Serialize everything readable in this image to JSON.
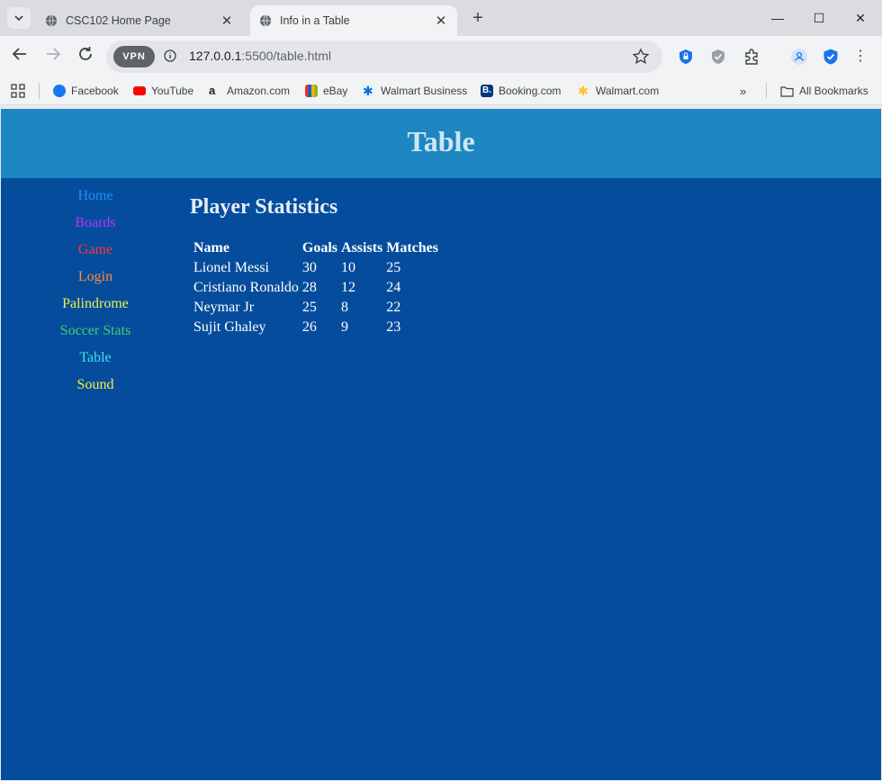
{
  "browser": {
    "tabs": [
      {
        "title": "CSC102 Home Page",
        "active": false
      },
      {
        "title": "Info in a Table",
        "active": true
      }
    ],
    "url_host": "127.0.0.1",
    "url_rest": ":5500/table.html",
    "vpn_label": "VPN",
    "bookmarks": [
      {
        "label": "Facebook",
        "icon": "facebook-icon",
        "color": "#1877f2"
      },
      {
        "label": "YouTube",
        "icon": "youtube-icon",
        "color": "#ff0000"
      },
      {
        "label": "Amazon.com",
        "icon": "amazon-icon",
        "color": "#222222"
      },
      {
        "label": "eBay",
        "icon": "ebay-icon",
        "color": "#e53238"
      },
      {
        "label": "Walmart Business",
        "icon": "walmart-business-icon",
        "color": "#0071dc"
      },
      {
        "label": "Booking.com",
        "icon": "booking-icon",
        "color": "#003580"
      },
      {
        "label": "Walmart.com",
        "icon": "walmart-icon",
        "color": "#ffc220"
      }
    ],
    "all_bookmarks": "All Bookmarks"
  },
  "page": {
    "title": "Table",
    "nav": [
      {
        "label": "Home",
        "color": "#1e90ff"
      },
      {
        "label": "Boards",
        "color": "#b533ff"
      },
      {
        "label": "Game",
        "color": "#ff3344"
      },
      {
        "label": "Login",
        "color": "#ff8c40"
      },
      {
        "label": "Palindrome",
        "color": "#e8f050"
      },
      {
        "label": "Soccer Stats",
        "color": "#40d070"
      },
      {
        "label": "Table",
        "color": "#40e0f0"
      },
      {
        "label": "Sound",
        "color": "#f0f040"
      }
    ],
    "section_title": "Player Statistics",
    "table": {
      "headers": [
        "Name",
        "Goals",
        "Assists",
        "Matches"
      ],
      "rows": [
        [
          "Lionel Messi",
          "30",
          "10",
          "25"
        ],
        [
          "Cristiano Ronaldo",
          "28",
          "12",
          "24"
        ],
        [
          "Neymar Jr",
          "25",
          "8",
          "22"
        ],
        [
          "Sujit Ghaley",
          "26",
          "9",
          "23"
        ]
      ]
    }
  }
}
